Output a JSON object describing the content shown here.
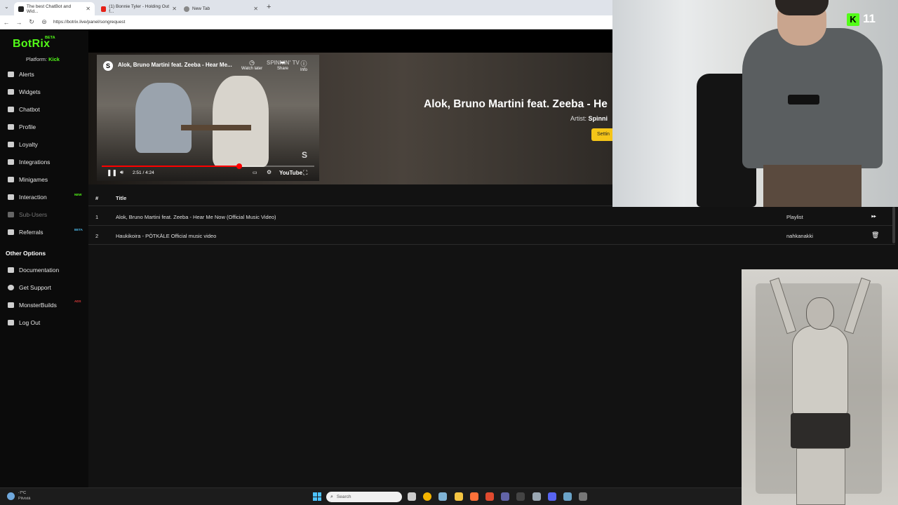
{
  "browser": {
    "tabs": [
      {
        "label": "The best ChatBot and Wid...",
        "active": true,
        "favicon_color": "#222222"
      },
      {
        "label": "(1) Bonnie Tyler - Holding Out f...",
        "active": false,
        "favicon_color": "#e62117"
      },
      {
        "label": "New Tab",
        "active": false,
        "favicon_color": "#888888"
      }
    ],
    "url": "https://botrix.live/panel/songrequest"
  },
  "sidebar": {
    "logo": "BotRix",
    "logo_badge": "BETA",
    "platform_label": "Platform:",
    "platform_value": "Kick",
    "items": [
      {
        "label": "Alerts",
        "icon": "alert-icon"
      },
      {
        "label": "Widgets",
        "icon": "widgets-icon"
      },
      {
        "label": "Chatbot",
        "icon": "chat-icon"
      },
      {
        "label": "Profile",
        "icon": "profile-icon"
      },
      {
        "label": "Loyalty",
        "icon": "trophy-icon"
      },
      {
        "label": "Integrations",
        "icon": "integrations-icon"
      },
      {
        "label": "Minigames",
        "icon": "gamepad-icon"
      },
      {
        "label": "Interaction",
        "icon": "music-icon",
        "badge": "NEW"
      },
      {
        "label": "Sub-Users",
        "icon": "users-icon",
        "disabled": true
      },
      {
        "label": "Referrals",
        "icon": "referrals-icon",
        "badge": "BETA"
      }
    ],
    "other_options_heading": "Other Options",
    "other_items": [
      {
        "label": "Documentation",
        "icon": "book-icon"
      },
      {
        "label": "Get Support",
        "icon": "help-icon"
      },
      {
        "label": "MonsterBuilds",
        "icon": "laptop-icon",
        "badge": "ADS"
      },
      {
        "label": "Log Out",
        "icon": "logout-icon"
      }
    ]
  },
  "player": {
    "title": "Alok, Bruno Martini feat. Zeeba - Hear Me...",
    "watch_later": "Watch later",
    "share": "Share",
    "info": "Info",
    "watermark": "SPINNIN' TV",
    "time": "2:51 / 4:24",
    "progress_fraction": 0.647,
    "youtube_label": "YouTube"
  },
  "now_playing": {
    "title": "Alok, Bruno Martini feat. Zeeba - He",
    "artist_label": "Artist:",
    "artist_value": "Spinni",
    "settings_button": "Settin"
  },
  "queue": {
    "headers": {
      "num": "#",
      "title": "Title"
    },
    "rows": [
      {
        "num": "1",
        "title": "Alok, Bruno Martini feat. Zeeba - Hear Me Now (Official Music Video)",
        "user": "Playlist",
        "action_icon": "skip-icon"
      },
      {
        "num": "2",
        "title": "Haukikoira - PÖTKÄLE Official music video",
        "user": "nahkanakki",
        "action_icon": "trash-icon"
      }
    ]
  },
  "overlay": {
    "kick_icon": "K",
    "viewer_count": "11"
  },
  "taskbar": {
    "weather_temp": "-7°C",
    "weather_condition": "Pilvistä",
    "search_placeholder": "Search",
    "apps": [
      {
        "name": "task-view-icon",
        "color": "#cccccc"
      },
      {
        "name": "chrome-icon",
        "color": "#f4b400"
      },
      {
        "name": "steam-icon",
        "color": "#7fb3d5"
      },
      {
        "name": "folder-icon",
        "color": "#f5c542"
      },
      {
        "name": "firefox-icon",
        "color": "#ff7139"
      },
      {
        "name": "app-red-icon",
        "color": "#e04a2f"
      },
      {
        "name": "teams-icon",
        "color": "#6264a7"
      },
      {
        "name": "terminal-icon",
        "color": "#444444"
      },
      {
        "name": "settings-icon",
        "color": "#9aa7b3"
      },
      {
        "name": "discord-icon",
        "color": "#5865f2"
      },
      {
        "name": "steam-alt-icon",
        "color": "#6aa3c8"
      },
      {
        "name": "obs-icon",
        "color": "#777777"
      }
    ]
  }
}
